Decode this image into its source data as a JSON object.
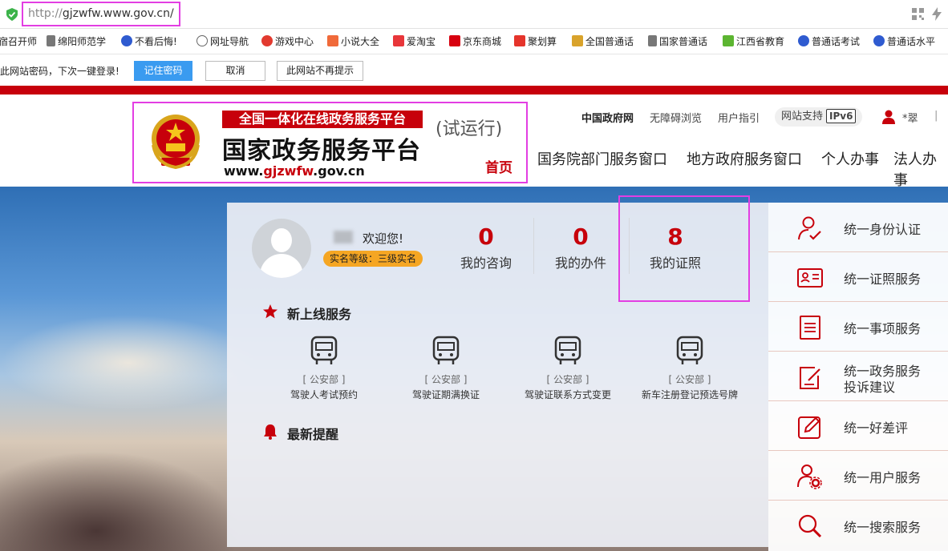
{
  "browser": {
    "url_prefix": "http://",
    "url_host": "gjzwfw.www.gov.cn/"
  },
  "bookmarks": [
    "宿召开师",
    "绵阳师范学",
    "不看后悔!",
    "网址导航",
    "游戏中心",
    "小说大全",
    "爱淘宝",
    "京东商城",
    "聚划算",
    "全国普通话",
    "国家普通话",
    "江西省教育",
    "普通话考试",
    "普通话水平"
  ],
  "password_bar": {
    "message": "此网站密码，下次一键登录!",
    "remember": "记住密码",
    "cancel": "取消",
    "never": "此网站不再提示"
  },
  "header": {
    "tagline": "全国一体化在线政务服务平台",
    "trial": "(试运行)",
    "title": "国家政务服务平台",
    "url_www": "www.",
    "url_red": "gjzwfw",
    "url_tail": ".gov.cn",
    "home": "首页",
    "links": [
      "中国政府网",
      "无障碍浏览",
      "用户指引"
    ],
    "ipv6_label": "网站支持",
    "ipv6_badge": "IPv6",
    "user": "*翠",
    "sep": "|",
    "nav": [
      "国务院部门服务窗口",
      "地方政府服务窗口",
      "个人办事",
      "法人办事"
    ]
  },
  "user_panel": {
    "welcome": "欢迎您!",
    "level": "实名等级：三级实名",
    "stats": [
      {
        "num": "0",
        "label": "我的咨询"
      },
      {
        "num": "0",
        "label": "我的办件"
      },
      {
        "num": "8",
        "label": "我的证照"
      }
    ],
    "new_services_title": "新上线服务",
    "services": [
      {
        "dept": "[ 公安部 ]",
        "name": "驾驶人考试预约"
      },
      {
        "dept": "[ 公安部 ]",
        "name": "驾驶证期满换证"
      },
      {
        "dept": "[ 公安部 ]",
        "name": "驾驶证联系方式变更"
      },
      {
        "dept": "[ 公安部 ]",
        "name": "新车注册登记预选号牌"
      }
    ],
    "reminder_title": "最新提醒"
  },
  "sidebar": [
    {
      "label": "统一身份认证"
    },
    {
      "label": "统一证照服务"
    },
    {
      "label": "统一事项服务"
    },
    {
      "label1": "统一政务服务",
      "label2": "投诉建议"
    },
    {
      "label": "统一好差评"
    },
    {
      "label": "统一用户服务"
    },
    {
      "label": "统一搜索服务"
    }
  ],
  "colors": {
    "accent": "#c7000b",
    "highlight": "#e33ee3",
    "primary_btn": "#3a9bf0"
  }
}
